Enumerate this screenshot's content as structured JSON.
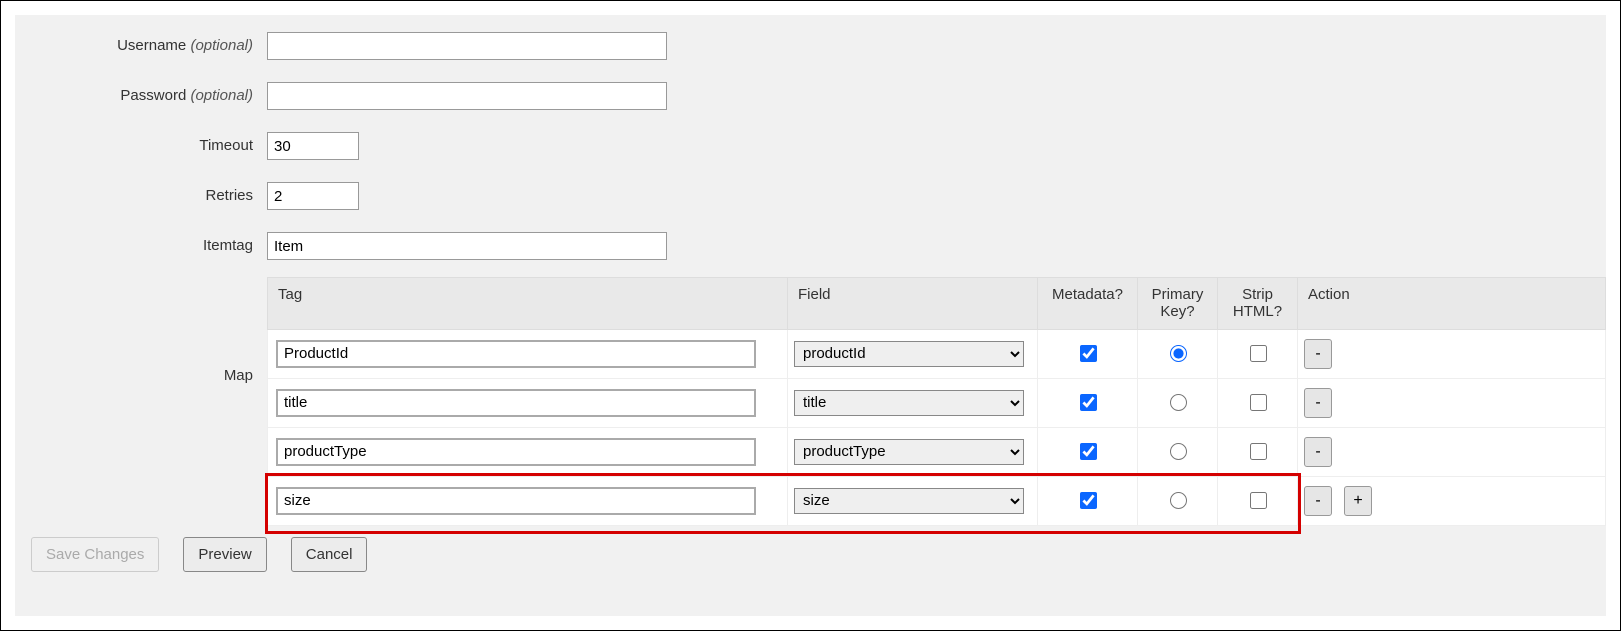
{
  "form": {
    "username": {
      "label": "Username",
      "hint": "(optional)",
      "value": ""
    },
    "password": {
      "label": "Password",
      "hint": "(optional)",
      "value": ""
    },
    "timeout": {
      "label": "Timeout",
      "value": "30"
    },
    "retries": {
      "label": "Retries",
      "value": "2"
    },
    "itemtag": {
      "label": "Itemtag",
      "value": "Item"
    },
    "map_label": "Map"
  },
  "table": {
    "headers": {
      "tag": "Tag",
      "field": "Field",
      "metadata": "Metadata?",
      "primary_key": "Primary Key?",
      "strip_html": "Strip HTML?",
      "action": "Action"
    },
    "rows": [
      {
        "tag": "ProductId",
        "field": "productId",
        "metadata": true,
        "primary_key": true,
        "strip_html": false,
        "show_add": false
      },
      {
        "tag": "title",
        "field": "title",
        "metadata": true,
        "primary_key": false,
        "strip_html": false,
        "show_add": false
      },
      {
        "tag": "productType",
        "field": "productType",
        "metadata": true,
        "primary_key": false,
        "strip_html": false,
        "show_add": false
      },
      {
        "tag": "size",
        "field": "size",
        "metadata": true,
        "primary_key": false,
        "strip_html": false,
        "show_add": true
      }
    ],
    "remove_label": "-",
    "add_label": "+"
  },
  "buttons": {
    "save": "Save Changes",
    "preview": "Preview",
    "cancel": "Cancel"
  },
  "highlight_row_index": 3
}
